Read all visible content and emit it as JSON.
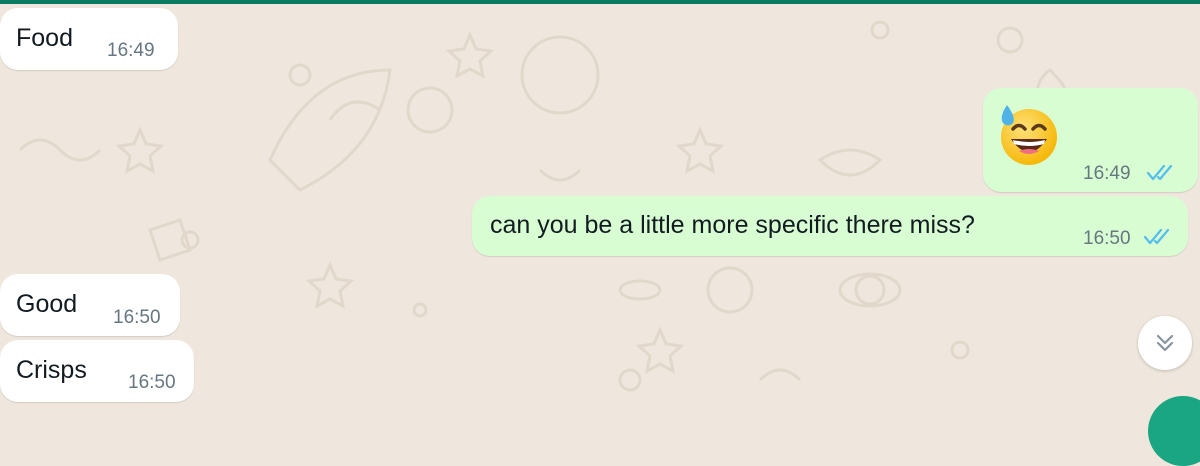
{
  "messages": [
    {
      "direction": "incoming",
      "text": "Food",
      "time": "16:49"
    },
    {
      "direction": "outgoing",
      "emoji": "grinning-face-with-sweat",
      "time": "16:49",
      "status": "read"
    },
    {
      "direction": "outgoing",
      "text": "can you be a little more specific there miss?",
      "time": "16:50",
      "status": "read"
    },
    {
      "direction": "incoming",
      "text": "Good",
      "time": "16:50"
    },
    {
      "direction": "incoming",
      "text": "Crisps",
      "time": "16:50"
    }
  ],
  "colors": {
    "accent": "#0b7a62",
    "background": "#efe7dd",
    "incoming_bubble": "#ffffff",
    "outgoing_bubble": "#d9fdd3",
    "read_ticks": "#53bdeb",
    "timestamp": "#667781"
  },
  "icons": {
    "read_status": "double-check-icon",
    "scroll_down": "double-chevron-down-icon"
  }
}
